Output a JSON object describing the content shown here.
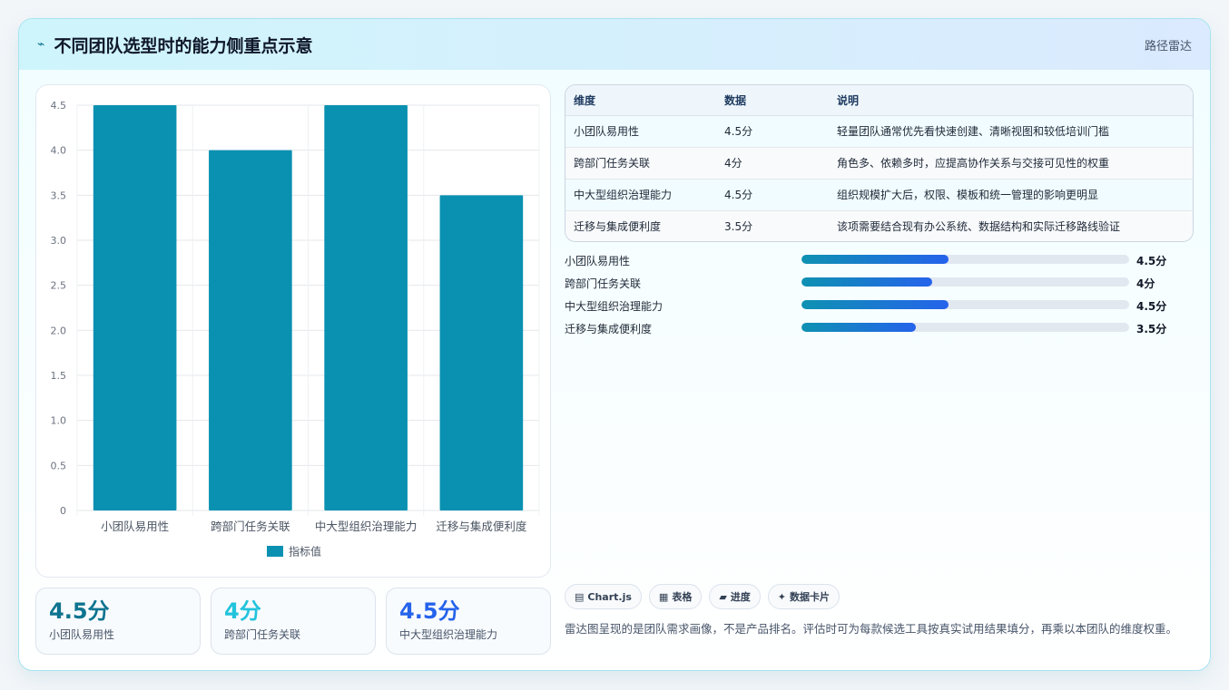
{
  "header": {
    "icon": "pulse-icon",
    "title": "不同团队选型时的能力侧重点示意",
    "tag": "路径雷达"
  },
  "chart_data": {
    "type": "bar",
    "categories": [
      "小团队易用性",
      "跨部门任务关联",
      "中大型组织治理能力",
      "迁移与集成便利度"
    ],
    "series": [
      {
        "name": "指标值",
        "values": [
          4.5,
          4.0,
          4.5,
          3.5
        ],
        "color": "#0a91b1"
      }
    ],
    "y_ticks": [
      "0",
      "0.5",
      "1.0",
      "1.5",
      "2.0",
      "2.5",
      "3.0",
      "3.5",
      "4.0",
      "4.5"
    ],
    "ylim": [
      0,
      4.5
    ],
    "grid": true,
    "legend": "bottom"
  },
  "stats": [
    {
      "value": "4.5分",
      "label": "小团队易用性",
      "color": "#0e7490"
    },
    {
      "value": "4分",
      "label": "跨部门任务关联",
      "color": "#22c3dc"
    },
    {
      "value": "4.5分",
      "label": "中大型组织治理能力",
      "color": "#2563eb"
    }
  ],
  "table": {
    "headers": [
      "维度",
      "数据",
      "说明"
    ],
    "rows": [
      [
        "小团队易用性",
        "4.5分",
        "轻量团队通常优先看快速创建、清晰视图和较低培训门槛"
      ],
      [
        "跨部门任务关联",
        "4分",
        "角色多、依赖多时，应提高协作关系与交接可见性的权重"
      ],
      [
        "中大型组织治理能力",
        "4.5分",
        "组织规模扩大后，权限、模板和统一管理的影响更明显"
      ],
      [
        "迁移与集成便利度",
        "3.5分",
        "该项需要结合现有办公系统、数据结构和实际迁移路线验证"
      ]
    ]
  },
  "progress": [
    {
      "label": "小团队易用性",
      "value": "4.5分",
      "fraction": 0.45
    },
    {
      "label": "跨部门任务关联",
      "value": "4分",
      "fraction": 0.4
    },
    {
      "label": "中大型组织治理能力",
      "value": "4.5分",
      "fraction": 0.45
    },
    {
      "label": "迁移与集成便利度",
      "value": "3.5分",
      "fraction": 0.35
    }
  ],
  "chips": [
    {
      "icon": "chart-icon",
      "label": "Chart.js"
    },
    {
      "icon": "table-icon",
      "label": "表格"
    },
    {
      "icon": "progress-icon",
      "label": "进度"
    },
    {
      "icon": "sparkle-icon",
      "label": "数据卡片"
    }
  ],
  "note": "雷达图呈现的是团队需求画像，不是产品排名。评估时可为每款候选工具按真实试用结果填分，再乘以本团队的维度权重。"
}
